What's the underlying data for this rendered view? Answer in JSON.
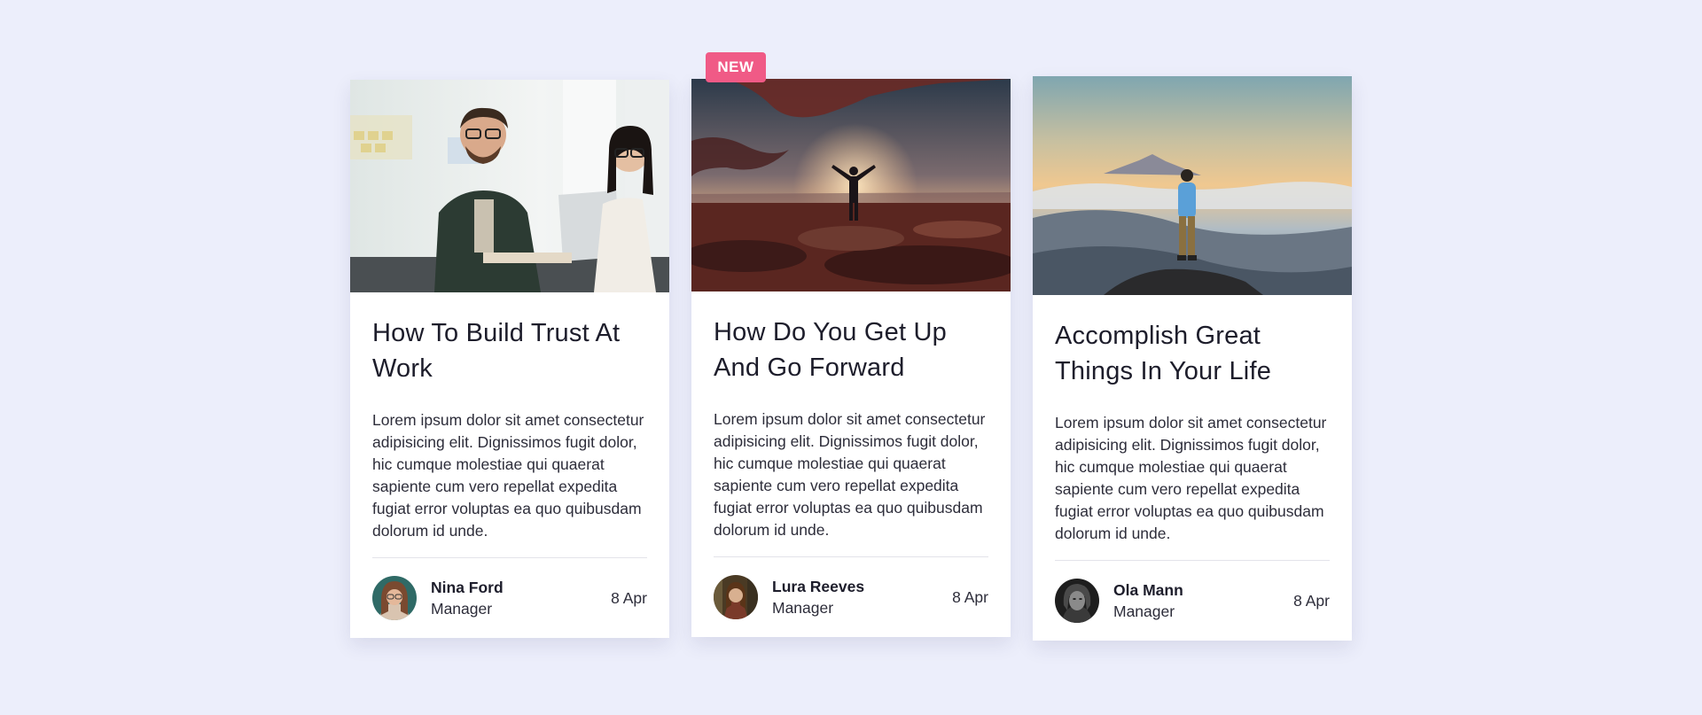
{
  "badge": {
    "label": "NEW"
  },
  "cards": [
    {
      "title": "How To Build Trust At Work",
      "description": "Lorem ipsum dolor sit amet consectetur adipisicing elit. Dignissimos fugit dolor, hic cumque molestiae qui quaerat sapiente cum vero repellat expedita fugiat error voluptas ea quo quibusdam dolorum id unde.",
      "author": {
        "name": "Nina Ford",
        "role": "Manager"
      },
      "date": "8 Apr"
    },
    {
      "title": "How Do You Get Up And Go Forward",
      "description": "Lorem ipsum dolor sit amet consectetur adipisicing elit. Dignissimos fugit dolor, hic cumque molestiae qui quaerat sapiente cum vero repellat expedita fugiat error voluptas ea quo quibusdam dolorum id unde.",
      "author": {
        "name": "Lura Reeves",
        "role": "Manager"
      },
      "date": "8 Apr"
    },
    {
      "title": "Accomplish Great Things In Your Life",
      "description": "Lorem ipsum dolor sit amet consectetur adipisicing elit. Dignissimos fugit dolor, hic cumque molestiae qui quaerat sapiente cum vero repellat expedita fugiat error voluptas ea quo quibusdam dolorum id unde.",
      "author": {
        "name": "Ola Mann",
        "role": "Manager"
      },
      "date": "8 Apr"
    }
  ],
  "colors": {
    "background": "#eceefb",
    "badge": "#f05a86",
    "card": "#ffffff"
  }
}
